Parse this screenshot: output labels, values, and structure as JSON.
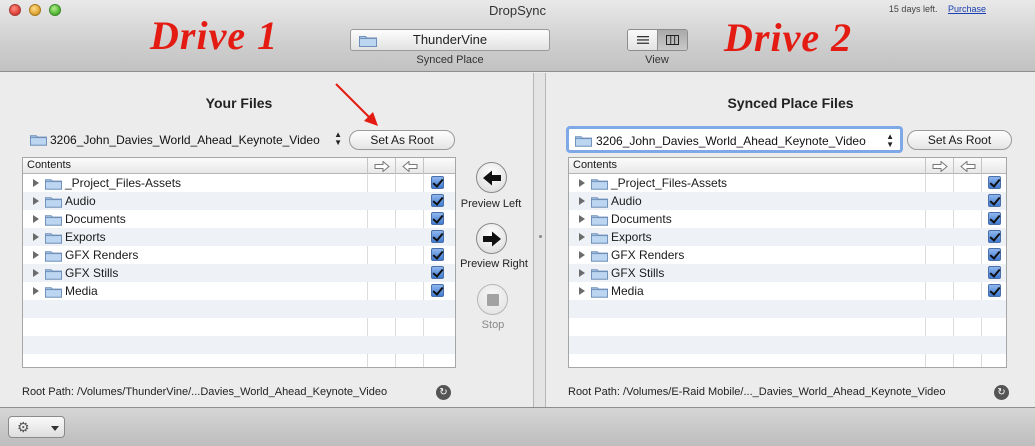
{
  "window": {
    "title": "DropSync",
    "trial_text": "15 days left.",
    "purchase_label": "Purchase"
  },
  "annotations": {
    "drive1": "Drive 1",
    "drive2": "Drive 2"
  },
  "toolbar": {
    "synced_place_value": "ThunderVine",
    "synced_place_caption": "Synced Place",
    "view_caption": "View"
  },
  "left": {
    "title": "Your Files",
    "path": "3206_John_Davies_World_Ahead_Keynote_Video",
    "set_root_label": "Set As Root",
    "column_header": "Contents",
    "items": [
      {
        "name": "_Project_Files-Assets",
        "checked": true
      },
      {
        "name": "Audio",
        "checked": true
      },
      {
        "name": "Documents",
        "checked": true
      },
      {
        "name": "Exports",
        "checked": true
      },
      {
        "name": "GFX Renders",
        "checked": true
      },
      {
        "name": "GFX Stills",
        "checked": true
      },
      {
        "name": "Media",
        "checked": true
      }
    ],
    "root_path": "Root Path:  /Volumes/ThunderVine/...Davies_World_Ahead_Keynote_Video"
  },
  "right": {
    "title": "Synced Place Files",
    "path": "3206_John_Davies_World_Ahead_Keynote_Video",
    "set_root_label": "Set As Root",
    "column_header": "Contents",
    "items": [
      {
        "name": "_Project_Files-Assets",
        "checked": true
      },
      {
        "name": "Audio",
        "checked": true
      },
      {
        "name": "Documents",
        "checked": true
      },
      {
        "name": "Exports",
        "checked": true
      },
      {
        "name": "GFX Renders",
        "checked": true
      },
      {
        "name": "GFX Stills",
        "checked": true
      },
      {
        "name": "Media",
        "checked": true
      }
    ],
    "root_path": "Root Path:  /Volumes/E-Raid Mobile/..._Davies_World_Ahead_Keynote_Video"
  },
  "middle": {
    "preview_left": "Preview Left",
    "preview_right": "Preview Right",
    "stop": "Stop"
  },
  "colors": {
    "annotation_red": "#e41b12",
    "checkbox_blue": "#3f7bd2",
    "focus_ring": "#7ea8e6"
  }
}
